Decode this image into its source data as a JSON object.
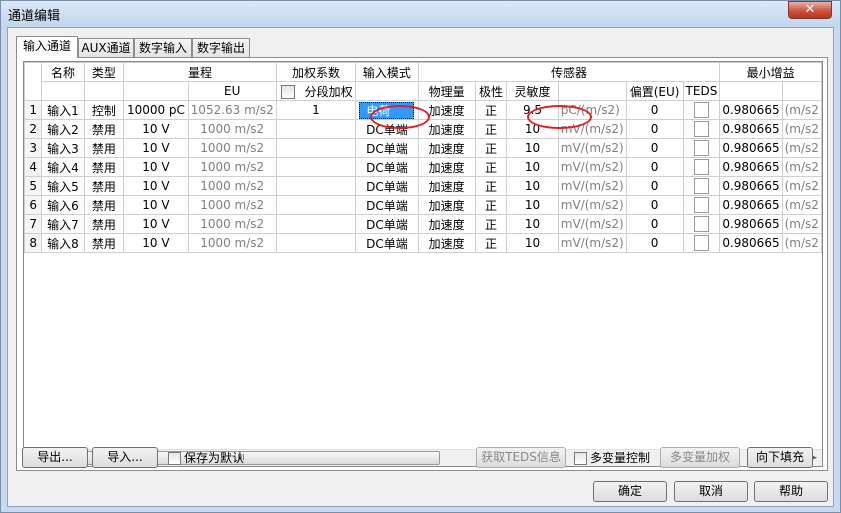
{
  "window": {
    "title": "通道编辑",
    "close_label": "✕"
  },
  "tabs": [
    "输入通道",
    "AUX通道",
    "数字输入",
    "数字输出"
  ],
  "table": {
    "group_headers": {
      "name": "名称",
      "type": "类型",
      "range": "量程",
      "weight": "加权系数",
      "input_mode": "输入模式",
      "sensor": "传感器",
      "min_gain": "最小增益"
    },
    "sub_headers": {
      "eu": "EU",
      "segment_weight": "分段加权",
      "physical": "物理量",
      "polarity": "极性",
      "sensitivity": "灵敏度",
      "offset": "偏置(EU)",
      "teds": "TEDS"
    },
    "rows": [
      {
        "no": "1",
        "name": "输入1",
        "type": "控制",
        "range": "10000 pC",
        "eu": "1052.63 m/s2",
        "weight": "1",
        "mode": "电荷",
        "physical": "加速度",
        "polarity": "正",
        "sensitivity": "9.5",
        "sens_unit": "pC/(m/s2)",
        "offset": "0",
        "min_gain": "0.980665",
        "gain_unit": "(m/s2"
      },
      {
        "no": "2",
        "name": "输入2",
        "type": "禁用",
        "range": "10 V",
        "eu": "1000 m/s2",
        "weight": "",
        "mode": "DC单端",
        "physical": "加速度",
        "polarity": "正",
        "sensitivity": "10",
        "sens_unit": "mV/(m/s2)",
        "offset": "0",
        "min_gain": "0.980665",
        "gain_unit": "(m/s2"
      },
      {
        "no": "3",
        "name": "输入3",
        "type": "禁用",
        "range": "10 V",
        "eu": "1000 m/s2",
        "weight": "",
        "mode": "DC单端",
        "physical": "加速度",
        "polarity": "正",
        "sensitivity": "10",
        "sens_unit": "mV/(m/s2)",
        "offset": "0",
        "min_gain": "0.980665",
        "gain_unit": "(m/s2"
      },
      {
        "no": "4",
        "name": "输入4",
        "type": "禁用",
        "range": "10 V",
        "eu": "1000 m/s2",
        "weight": "",
        "mode": "DC单端",
        "physical": "加速度",
        "polarity": "正",
        "sensitivity": "10",
        "sens_unit": "mV/(m/s2)",
        "offset": "0",
        "min_gain": "0.980665",
        "gain_unit": "(m/s2"
      },
      {
        "no": "5",
        "name": "输入5",
        "type": "禁用",
        "range": "10 V",
        "eu": "1000 m/s2",
        "weight": "",
        "mode": "DC单端",
        "physical": "加速度",
        "polarity": "正",
        "sensitivity": "10",
        "sens_unit": "mV/(m/s2)",
        "offset": "0",
        "min_gain": "0.980665",
        "gain_unit": "(m/s2"
      },
      {
        "no": "6",
        "name": "输入6",
        "type": "禁用",
        "range": "10 V",
        "eu": "1000 m/s2",
        "weight": "",
        "mode": "DC单端",
        "physical": "加速度",
        "polarity": "正",
        "sensitivity": "10",
        "sens_unit": "mV/(m/s2)",
        "offset": "0",
        "min_gain": "0.980665",
        "gain_unit": "(m/s2"
      },
      {
        "no": "7",
        "name": "输入7",
        "type": "禁用",
        "range": "10 V",
        "eu": "1000 m/s2",
        "weight": "",
        "mode": "DC单端",
        "physical": "加速度",
        "polarity": "正",
        "sensitivity": "10",
        "sens_unit": "mV/(m/s2)",
        "offset": "0",
        "min_gain": "0.980665",
        "gain_unit": "(m/s2"
      },
      {
        "no": "8",
        "name": "输入8",
        "type": "禁用",
        "range": "10 V",
        "eu": "1000 m/s2",
        "weight": "",
        "mode": "DC单端",
        "physical": "加速度",
        "polarity": "正",
        "sensitivity": "10",
        "sens_unit": "mV/(m/s2)",
        "offset": "0",
        "min_gain": "0.980665",
        "gain_unit": "(m/s2"
      }
    ],
    "scroll_thumb_label": "III"
  },
  "bottom_bar": {
    "export": "导出...",
    "import": "导入...",
    "save_default": "保存为默认",
    "get_teds": "获取TEDS信息",
    "multi_var_control": "多变量控制",
    "multi_var_weight": "多变量加权",
    "fill_down": "向下填充"
  },
  "dialog_buttons": {
    "ok": "确定",
    "cancel": "取消",
    "help": "帮助"
  },
  "colors": {
    "selection": "#3399ff",
    "highlight_oval": "#e02020",
    "window_frame": "#c7daf0"
  }
}
